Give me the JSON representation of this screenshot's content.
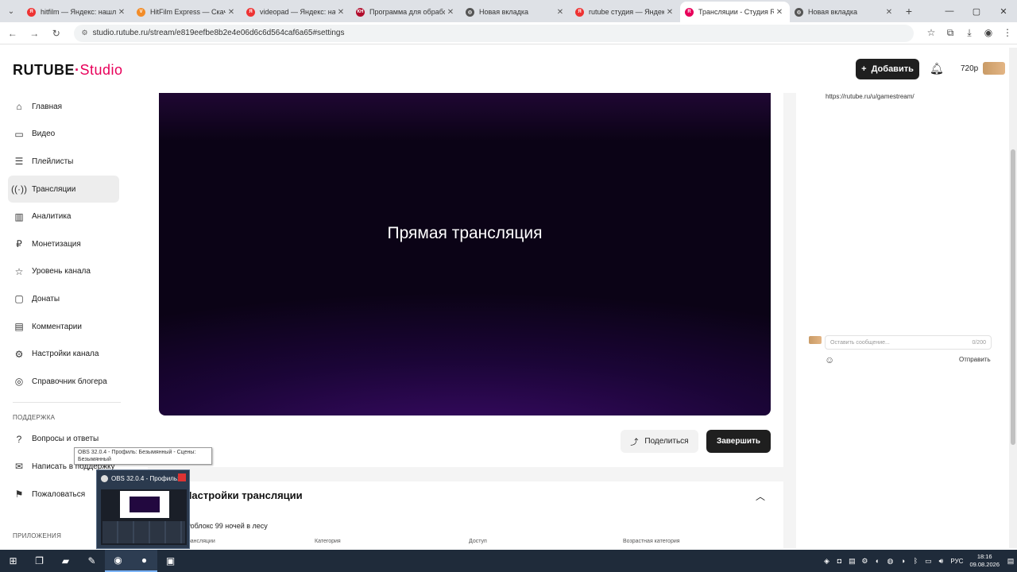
{
  "browser": {
    "tabs": [
      {
        "title": "hitfilm — Яндекс: нашлось",
        "fav": "Я",
        "color": "#e33"
      },
      {
        "title": "HitFilm Express — Скачать",
        "fav": "V",
        "color": "#f28c28"
      },
      {
        "title": "videopad — Яндекс: нашлось",
        "fav": "Я",
        "color": "#e33"
      },
      {
        "title": "Программа для обработки",
        "fav": "КН",
        "color": "#b10c2c"
      },
      {
        "title": "Новая вкладка",
        "fav": "◎",
        "color": "#555"
      },
      {
        "title": "rutube студия — Яндекс: на",
        "fav": "Я",
        "color": "#e33"
      },
      {
        "title": "Трансляции - Студия RUTUBE",
        "fav": "R",
        "color": "#e8005a"
      },
      {
        "title": "Новая вкладка",
        "fav": "◎",
        "color": "#555"
      }
    ],
    "active_tab": 6,
    "url": "studio.rutube.ru/stream/e819eefbe8b2e4e06d6c6d564caf6a65#settings"
  },
  "header": {
    "logo_brand": "RUTUBE",
    "logo_studio": "Studio",
    "add_label": "Добавить",
    "quality": "720p"
  },
  "sidebar": {
    "items": [
      {
        "label": "Главная",
        "icon": "⌂"
      },
      {
        "label": "Видео",
        "icon": "▭"
      },
      {
        "label": "Плейлисты",
        "icon": "☰"
      },
      {
        "label": "Трансляции",
        "icon": "((·))"
      },
      {
        "label": "Аналитика",
        "icon": "▥"
      },
      {
        "label": "Монетизация",
        "icon": "₽"
      },
      {
        "label": "Уровень канала",
        "icon": "☆"
      },
      {
        "label": "Донаты",
        "icon": "▢"
      },
      {
        "label": "Комментарии",
        "icon": "▤"
      },
      {
        "label": "Настройки канала",
        "icon": "⚙"
      },
      {
        "label": "Справочник блогера",
        "icon": "◎"
      }
    ],
    "support_title": "ПОДДЕРЖКА",
    "support_items": [
      {
        "label": "Вопросы и ответы",
        "icon": "?"
      },
      {
        "label": "Написать в поддержку",
        "icon": "✉"
      },
      {
        "label": "Пожаловаться",
        "icon": "⚑"
      }
    ],
    "apps_title": "ПРИЛОЖЕНИЯ"
  },
  "player": {
    "title": "Прямая трансляция"
  },
  "actions": {
    "share": "Поделиться",
    "finish": "Завершить"
  },
  "settings": {
    "title": "Настройки трансляции",
    "stream_name": "Роблокс 99 ночей в лесу",
    "field_labels": [
      "Трансляции",
      "Категория",
      "Доступ",
      "Возрастная категория"
    ]
  },
  "chat": {
    "link": "https://rutube.ru/u/gamestream/",
    "placeholder": "Оставить сообщение...",
    "counter": "0/200",
    "send": "Отправить"
  },
  "obs": {
    "tooltip": "OBS 32.0.4 - Профиль: Безымянный - Сцены: Безымянный",
    "preview_title": "OBS 32.0.4 - Профиль: ..."
  },
  "taskbar": {
    "lang": "РУС",
    "time": "18:16",
    "date": "09.08.2026"
  }
}
